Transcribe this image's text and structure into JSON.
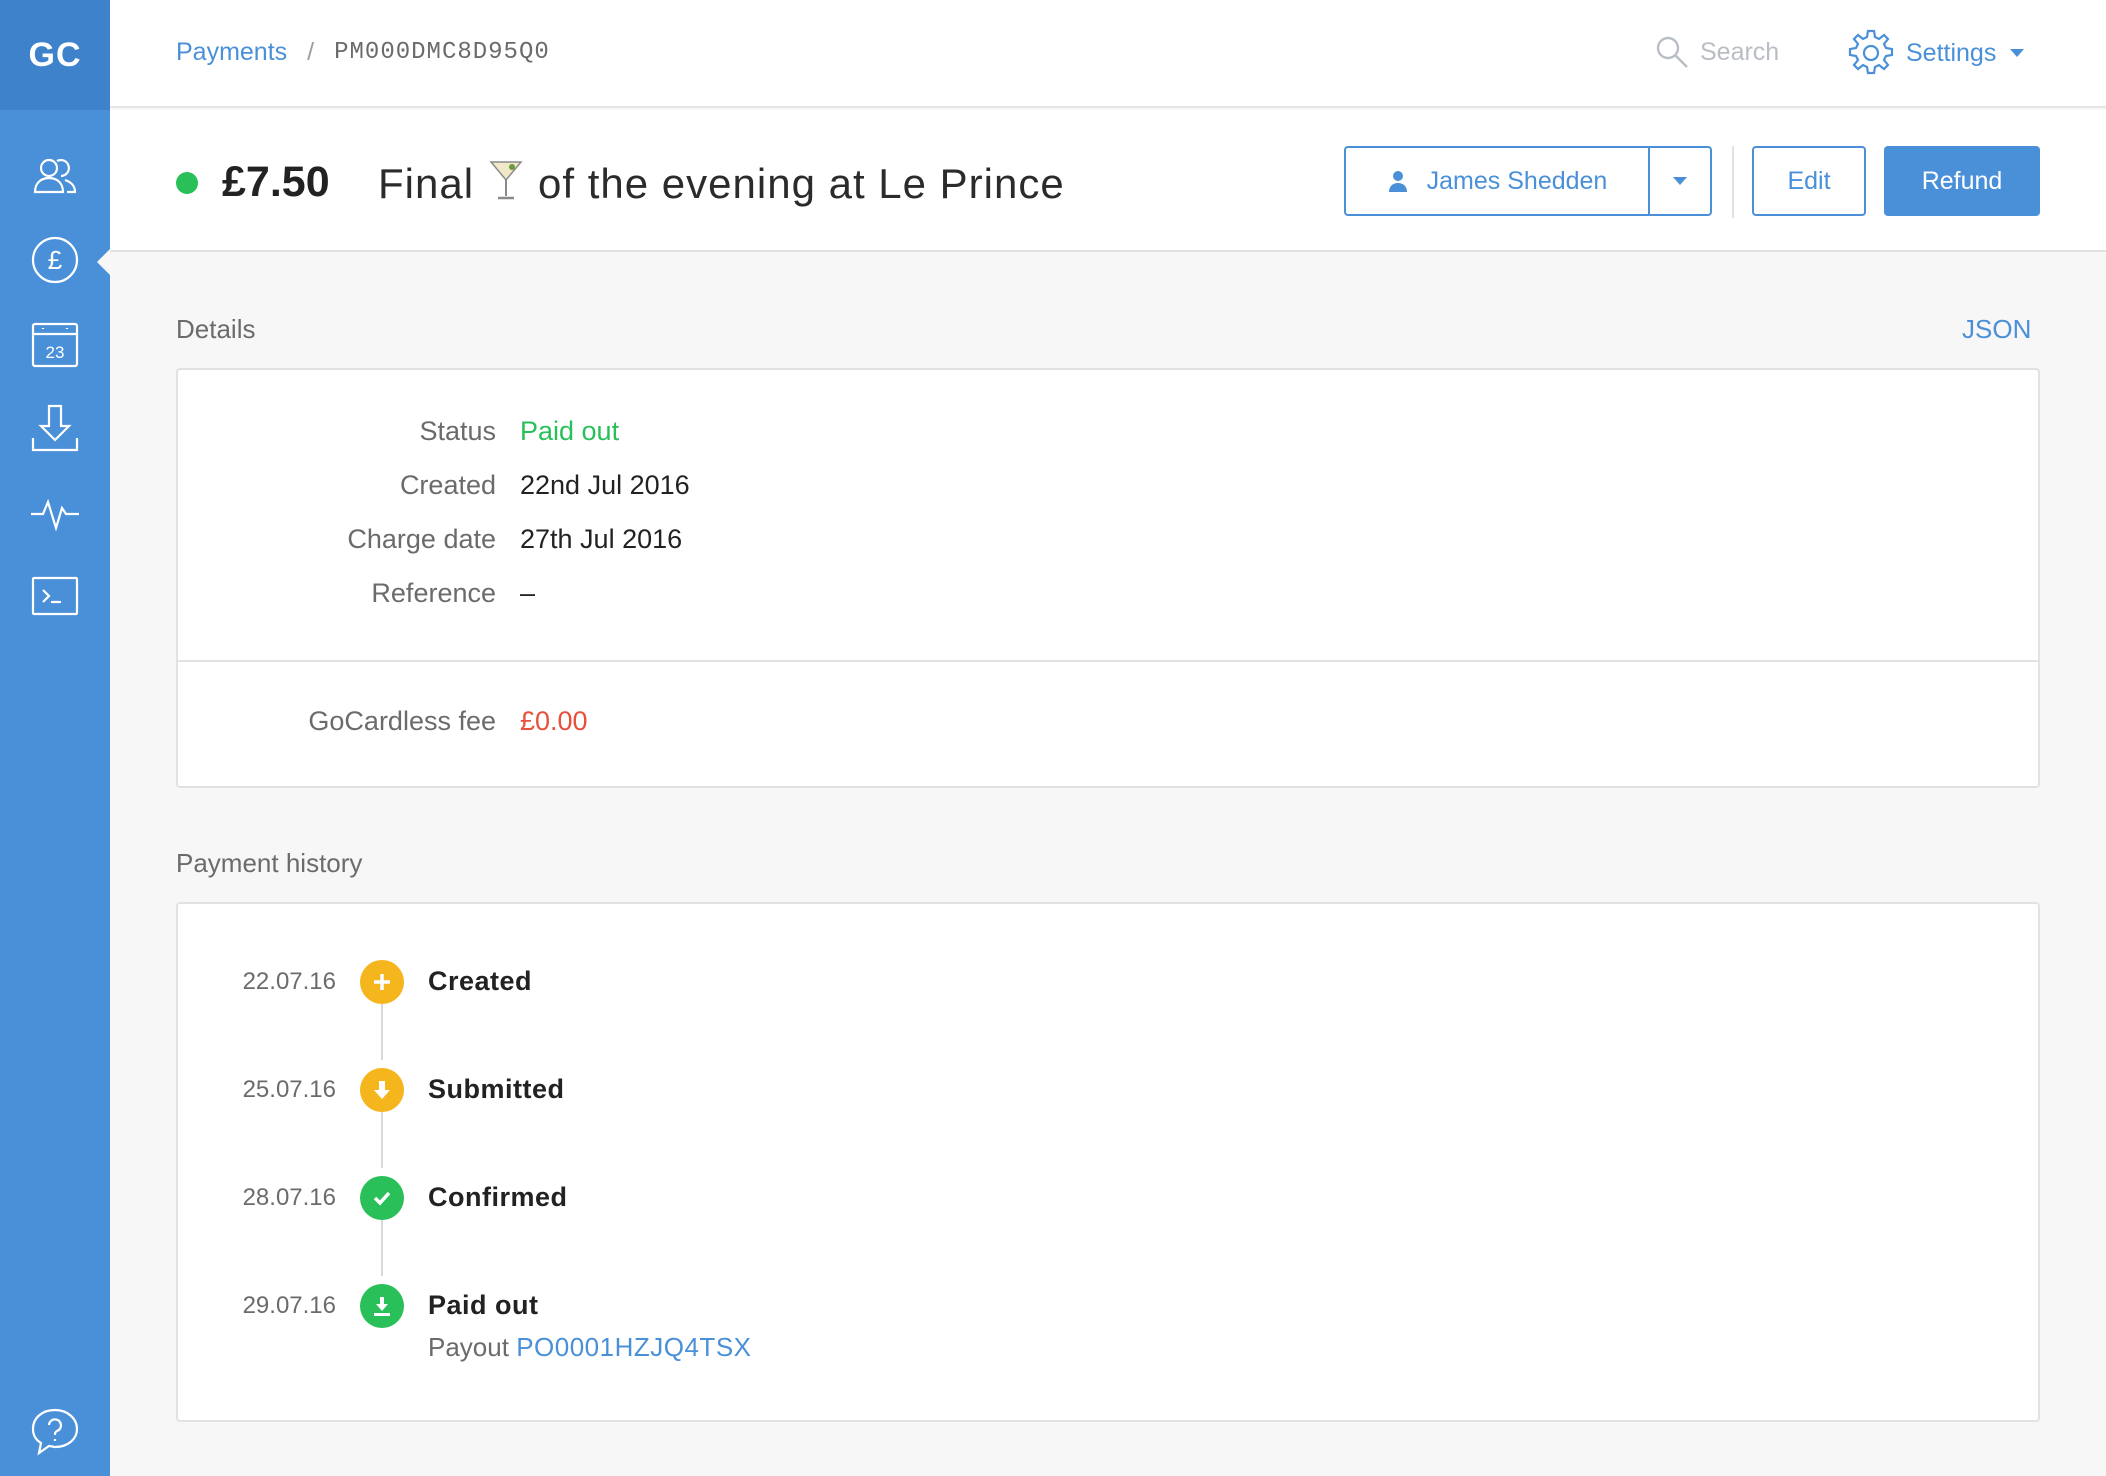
{
  "sidebar": {
    "logo": "GC",
    "items": [
      {
        "icon": "customers-icon"
      },
      {
        "icon": "pound-icon",
        "active": true
      },
      {
        "icon": "calendar-icon",
        "label": "23"
      },
      {
        "icon": "download-icon"
      },
      {
        "icon": "activity-icon"
      },
      {
        "icon": "terminal-icon"
      }
    ],
    "help_icon": "help-icon"
  },
  "breadcrumb": {
    "parent": "Payments",
    "separator": "/",
    "current": "PM000DMC8D95Q0"
  },
  "search": {
    "placeholder": "Search"
  },
  "settings": {
    "label": "Settings"
  },
  "header": {
    "amount": "£7.50",
    "description_before": "Final",
    "description_after": "of the evening at Le Prince",
    "customer_button": "James Shedden",
    "edit_button": "Edit",
    "refund_button": "Refund",
    "status_color": "#29c05a"
  },
  "details": {
    "title": "Details",
    "json_link": "JSON",
    "rows": [
      {
        "label": "Status",
        "value": "Paid out"
      },
      {
        "label": "Created",
        "value": "22nd Jul 2016"
      },
      {
        "label": "Charge date",
        "value": "27th Jul 2016"
      },
      {
        "label": "Reference",
        "value": "–"
      }
    ],
    "fee": {
      "label": "GoCardless fee",
      "value": "£0.00"
    }
  },
  "history": {
    "title": "Payment history",
    "events": [
      {
        "date": "22.07.16",
        "label": "Created",
        "icon": "plus-icon",
        "color": "#f5b51d"
      },
      {
        "date": "25.07.16",
        "label": "Submitted",
        "icon": "arrow-down-icon",
        "color": "#f5b51d"
      },
      {
        "date": "28.07.16",
        "label": "Confirmed",
        "icon": "check-icon",
        "color": "#29c05a"
      },
      {
        "date": "29.07.16",
        "label": "Paid out",
        "icon": "download-icon",
        "color": "#29c05a",
        "sub_prefix": "Payout",
        "sub_link": "PO0001HZJQ4TSX"
      }
    ]
  },
  "colors": {
    "brand": "#4a90d9",
    "success": "#29c05a",
    "warning": "#f5b51d",
    "danger": "#e7513b"
  }
}
